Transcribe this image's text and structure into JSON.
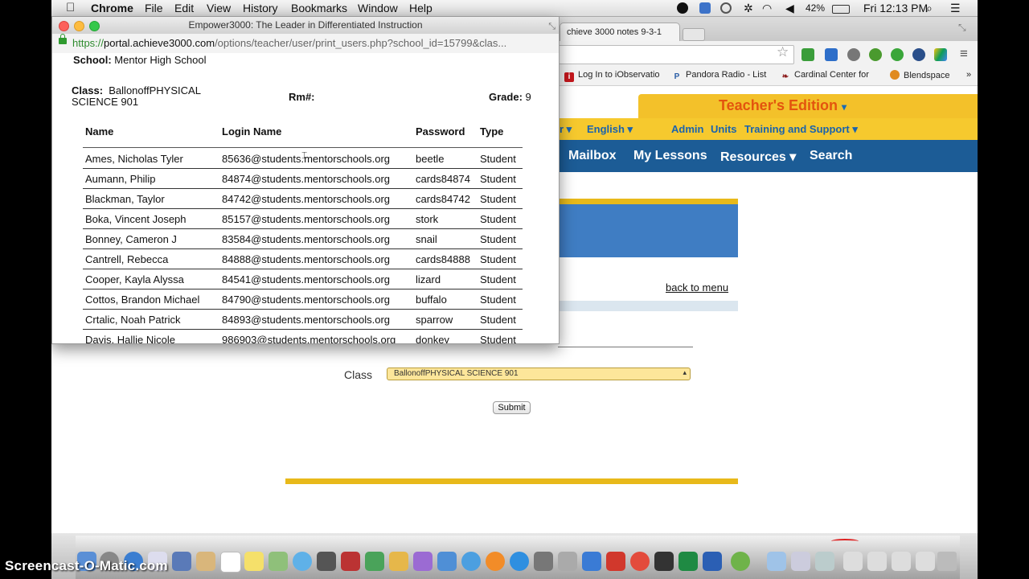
{
  "menubar": {
    "app": "Chrome",
    "items": [
      "File",
      "Edit",
      "View",
      "History",
      "Bookmarks",
      "Window",
      "Help"
    ],
    "battery": "42%",
    "clock": "Fri 12:13 PM"
  },
  "browser": {
    "tab_title": "chieve 3000 notes 9-3-1",
    "bookmarks": [
      {
        "label": "Log In to iObservatio",
        "color": "#c4161c"
      },
      {
        "label": "Pandora Radio - List",
        "color": "#2b5ea6"
      },
      {
        "label": "Cardinal Center for",
        "color": "#8c1d1d"
      },
      {
        "label": "Blendspace",
        "color": "#e08a1f"
      }
    ]
  },
  "page": {
    "edition_title": "Teacher's Edition",
    "caret": "▾",
    "yellow_nav": [
      "r ▾",
      "English ▾",
      "Admin",
      "Units",
      "Training and Support ▾"
    ],
    "blue_nav": [
      "Mailbox",
      "My Lessons",
      "Resources ▾",
      "Search"
    ],
    "back_to_menu": "back to menu",
    "class_label": "Class",
    "class_value": "BallonoffPHYSICAL SCIENCE 901",
    "submit": "Submit"
  },
  "popup": {
    "window_title": "Empower3000: The Leader in Differentiated Instruction",
    "url_scheme": "https://",
    "url_host": "portal.achieve3000.com",
    "url_path": "/options/teacher/user/print_users.php?school_id=15799&clas...",
    "school_label": "School:",
    "school_value": "Mentor High School",
    "class_label": "Class:",
    "class_value": "BallonoffPHYSICAL SCIENCE 901",
    "rm_label": "Rm#:",
    "grade_label": "Grade:",
    "grade_value": "9",
    "columns": [
      "Name",
      "Login Name",
      "Password",
      "Type"
    ],
    "rows": [
      [
        "Ames, Nicholas Tyler",
        "85636@students.mentorschools.org",
        "beetle",
        "Student"
      ],
      [
        "Aumann, Philip",
        "84874@students.mentorschools.org",
        "cards84874",
        "Student"
      ],
      [
        "Blackman, Taylor",
        "84742@students.mentorschools.org",
        "cards84742",
        "Student"
      ],
      [
        "Boka, Vincent Joseph",
        "85157@students.mentorschools.org",
        "stork",
        "Student"
      ],
      [
        "Bonney, Cameron J",
        "83584@students.mentorschools.org",
        "snail",
        "Student"
      ],
      [
        "Cantrell, Rebecca",
        "84888@students.mentorschools.org",
        "cards84888",
        "Student"
      ],
      [
        "Cooper, Kayla Alyssa",
        "84541@students.mentorschools.org",
        "lizard",
        "Student"
      ],
      [
        "Cottos, Brandon Michael",
        "84790@students.mentorschools.org",
        "buffalo",
        "Student"
      ],
      [
        "Crtalic, Noah Patrick",
        "84893@students.mentorschools.org",
        "sparrow",
        "Student"
      ],
      [
        "Davis, Hallie Nicole",
        "986903@students.mentorschools.org",
        "donkey",
        "Student"
      ]
    ]
  },
  "watermark": "Screencast-O-Matic.com"
}
